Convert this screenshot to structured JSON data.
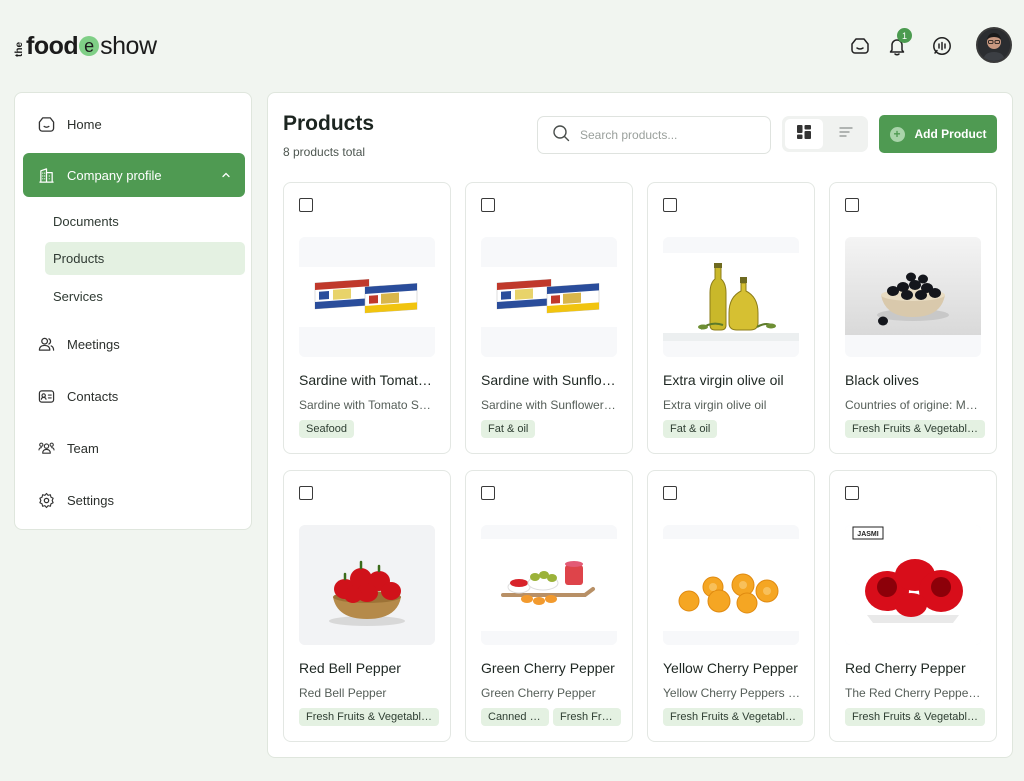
{
  "brand": {
    "the": "the",
    "food": "food",
    "e": "e",
    "show": "show"
  },
  "header": {
    "notification_count": "1"
  },
  "sidebar": {
    "items": [
      {
        "label": "Home"
      },
      {
        "label": "Company profile"
      },
      {
        "label": "Meetings"
      },
      {
        "label": "Contacts"
      },
      {
        "label": "Team"
      },
      {
        "label": "Settings"
      }
    ],
    "sub_items": [
      {
        "label": "Documents"
      },
      {
        "label": "Products"
      },
      {
        "label": "Services"
      }
    ]
  },
  "main": {
    "title": "Products",
    "subtitle": "8 products total",
    "search_placeholder": "Search products...",
    "add_button": "Add Product"
  },
  "products": [
    {
      "name": "Sardine with Tomato Sauce",
      "desc": "Sardine with Tomato Sauce",
      "tags": [
        "Seafood"
      ]
    },
    {
      "name": "Sardine with Sunflower Oil",
      "desc": "Sardine with Sunflower Oil",
      "tags": [
        "Fat & oil"
      ]
    },
    {
      "name": "Extra virgin olive oil",
      "desc": "Extra virgin olive oil",
      "tags": [
        "Fat & oil"
      ]
    },
    {
      "name": "Black olives",
      "desc": "Countries of origine: Morocco",
      "tags": [
        "Fresh Fruits & Vegetables"
      ]
    },
    {
      "name": "Red Bell Pepper",
      "desc": "Red Bell Pepper",
      "tags": [
        "Fresh Fruits & Vegetables"
      ]
    },
    {
      "name": "Green Cherry Pepper",
      "desc": "Green Cherry Pepper",
      "tags": [
        "Canned fruits",
        "Fresh Fruits & Vegetables"
      ]
    },
    {
      "name": "Yellow Cherry Pepper",
      "desc": "Yellow Cherry Peppers in brine",
      "tags": [
        "Fresh Fruits & Vegetables"
      ]
    },
    {
      "name": "Red Cherry Pepper",
      "desc": "The Red Cherry Peppers in brine",
      "tags": [
        "Fresh Fruits & Vegetables"
      ]
    }
  ],
  "image_labels": {
    "jasmi": "JASMI"
  },
  "colors": {
    "accent": "#4f9a52",
    "accent_light": "#e4f1e2",
    "background": "#f1f5f0"
  }
}
